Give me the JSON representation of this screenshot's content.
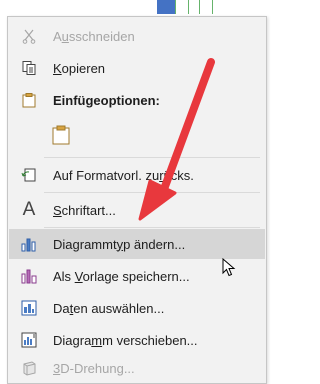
{
  "menu": {
    "items": [
      {
        "label_pre": "A",
        "label_u": "u",
        "label_post": "sschneiden",
        "icon": "scissors-icon",
        "disabled": true
      },
      {
        "label_pre": "",
        "label_u": "K",
        "label_post": "opieren",
        "icon": "copy-icon",
        "disabled": false
      },
      {
        "label_pre": "Einfügeoptionen:",
        "label_u": "",
        "label_post": "",
        "icon": "clipboard-icon",
        "disabled": false,
        "bold": true
      },
      {
        "label_pre": "",
        "label_u": "",
        "label_post": "",
        "icon": "paste-option-icon",
        "disabled": false
      },
      {
        "label_pre": "Auf Formatvorl. zu",
        "label_u": "r",
        "label_post": "ücks.",
        "icon": "reset-style-icon",
        "disabled": false
      },
      {
        "label_pre": "",
        "label_u": "S",
        "label_post": "chriftart...",
        "icon": "font-icon",
        "disabled": false
      },
      {
        "label_pre": "Diagrammt",
        "label_u": "y",
        "label_post": "p ändern...",
        "icon": "chart-type-icon",
        "disabled": false,
        "highlight": true
      },
      {
        "label_pre": "Als ",
        "label_u": "V",
        "label_post": "orlage speichern...",
        "icon": "save-template-icon",
        "disabled": false
      },
      {
        "label_pre": "Da",
        "label_u": "t",
        "label_post": "en auswählen...",
        "icon": "select-data-icon",
        "disabled": false
      },
      {
        "label_pre": "Diagra",
        "label_u": "m",
        "label_post": "m verschieben...",
        "icon": "move-chart-icon",
        "disabled": false
      },
      {
        "label_pre": "",
        "label_u": "3",
        "label_post": "D-Drehung...",
        "icon": "3d-rotation-icon",
        "disabled": true
      }
    ]
  },
  "colors": {
    "menu_bg": "#f2f2f2",
    "highlight_bg": "#d6d6d6",
    "arrow": "#e8383d",
    "text": "#1e1e1e",
    "disabled_text": "#a6a6a6"
  }
}
